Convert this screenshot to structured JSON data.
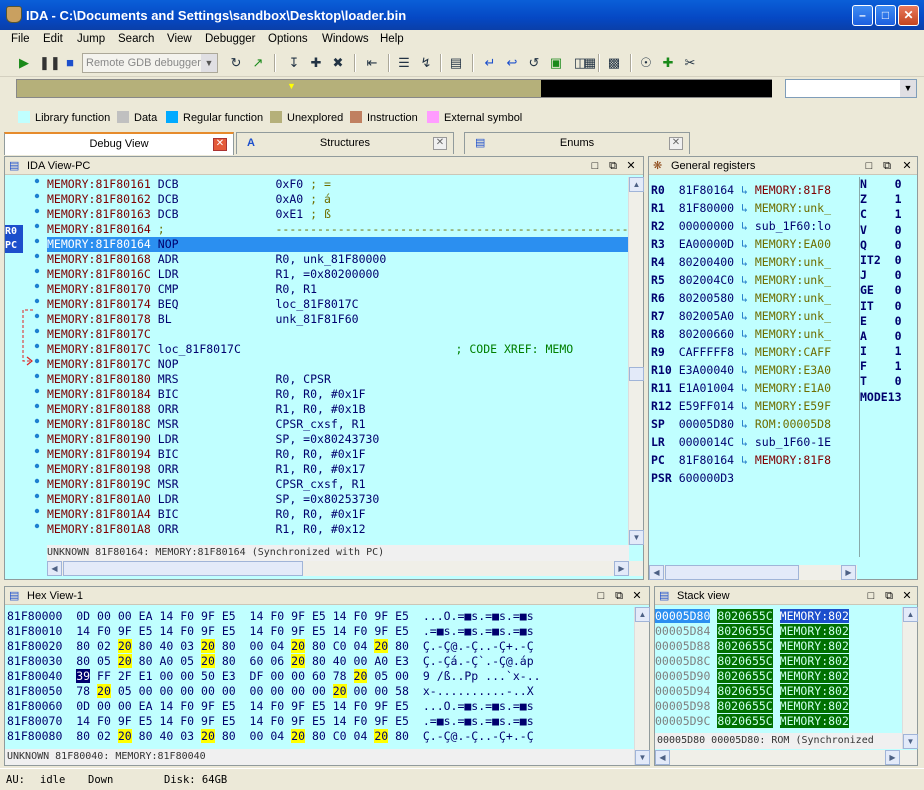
{
  "window": {
    "title": "IDA - C:\\Documents and Settings\\sandbox\\Desktop\\loader.bin"
  },
  "menu": [
    "File",
    "Edit",
    "Jump",
    "Search",
    "View",
    "Debugger",
    "Options",
    "Windows",
    "Help"
  ],
  "toolbar": {
    "debugger_select": "Remote GDB debugger"
  },
  "legend": [
    {
      "label": "Library function",
      "color": "#c0ffff"
    },
    {
      "label": "Data",
      "color": "#c0c0c0"
    },
    {
      "label": "Regular function",
      "color": "#00aaff"
    },
    {
      "label": "Unexplored",
      "color": "#b5b07a"
    },
    {
      "label": "Instruction",
      "color": "#c08060"
    },
    {
      "label": "External symbol",
      "color": "#ff9cff"
    }
  ],
  "tabs": [
    {
      "label": "Debug View",
      "active": true
    },
    {
      "label": "Structures",
      "active": false
    },
    {
      "label": "Enums",
      "active": false
    }
  ],
  "ida_view": {
    "title": "IDA View-PC",
    "markers": [
      "R0",
      "PC"
    ],
    "lines": [
      {
        "a": "MEMORY:81F80161",
        "m": "DCB",
        "o": "0xF0",
        "c": "; ="
      },
      {
        "a": "MEMORY:81F80162",
        "m": "DCB",
        "o": "0xA0",
        "c": "; á"
      },
      {
        "a": "MEMORY:81F80163",
        "m": "DCB",
        "o": "0xE1",
        "c": "; ß"
      },
      {
        "a": "MEMORY:81F80164",
        "m": ";",
        "o": "---------------------------------------------------------------",
        "c": ""
      },
      {
        "a": "MEMORY:81F80164",
        "m": "NOP",
        "o": "",
        "c": "",
        "sel": true
      },
      {
        "a": "MEMORY:81F80168",
        "m": "ADR",
        "o": "R0, unk_81F80000",
        "c": ""
      },
      {
        "a": "MEMORY:81F8016C",
        "m": "LDR",
        "o": "R1, =0x80200000",
        "c": ""
      },
      {
        "a": "MEMORY:81F80170",
        "m": "CMP",
        "o": "R0, R1",
        "c": ""
      },
      {
        "a": "MEMORY:81F80174",
        "m": "BEQ",
        "o": "loc_81F8017C",
        "c": ""
      },
      {
        "a": "MEMORY:81F80178",
        "m": "BL",
        "o": "unk_81F81F60",
        "c": ""
      },
      {
        "a": "MEMORY:81F8017C",
        "m": "",
        "o": "",
        "c": ""
      },
      {
        "a": "MEMORY:81F8017C",
        "m": "loc_81F8017C",
        "o": "",
        "c": "; CODE XREF: MEMO"
      },
      {
        "a": "MEMORY:81F8017C",
        "m": "NOP",
        "o": "",
        "c": ""
      },
      {
        "a": "MEMORY:81F80180",
        "m": "MRS",
        "o": "R0, CPSR",
        "c": ""
      },
      {
        "a": "MEMORY:81F80184",
        "m": "BIC",
        "o": "R0, R0, #0x1F",
        "c": ""
      },
      {
        "a": "MEMORY:81F80188",
        "m": "ORR",
        "o": "R1, R0, #0x1B",
        "c": ""
      },
      {
        "a": "MEMORY:81F8018C",
        "m": "MSR",
        "o": "CPSR_cxsf, R1",
        "c": ""
      },
      {
        "a": "MEMORY:81F80190",
        "m": "LDR",
        "o": "SP, =0x80243730",
        "c": ""
      },
      {
        "a": "MEMORY:81F80194",
        "m": "BIC",
        "o": "R0, R0, #0x1F",
        "c": ""
      },
      {
        "a": "MEMORY:81F80198",
        "m": "ORR",
        "o": "R1, R0, #0x17",
        "c": ""
      },
      {
        "a": "MEMORY:81F8019C",
        "m": "MSR",
        "o": "CPSR_cxsf, R1",
        "c": ""
      },
      {
        "a": "MEMORY:81F801A0",
        "m": "LDR",
        "o": "SP, =0x80253730",
        "c": ""
      },
      {
        "a": "MEMORY:81F801A4",
        "m": "BIC",
        "o": "R0, R0, #0x1F",
        "c": ""
      },
      {
        "a": "MEMORY:81F801A8",
        "m": "ORR",
        "o": "R1, R0, #0x12",
        "c": ""
      }
    ],
    "status": "UNKNOWN 81F80164: MEMORY:81F80164 (Synchronized with PC)"
  },
  "registers": {
    "title": "General registers",
    "rows": [
      {
        "n": "R0",
        "v": "81F80164",
        "s": "MEMORY:81F8",
        "k": "red"
      },
      {
        "n": "R1",
        "v": "81F80000",
        "s": "MEMORY:unk_",
        "k": ""
      },
      {
        "n": "R2",
        "v": "00000000",
        "s": "sub_1F60:lo",
        "k": "blue"
      },
      {
        "n": "R3",
        "v": "EA00000D",
        "s": "MEMORY:EA00",
        "k": ""
      },
      {
        "n": "R4",
        "v": "80200400",
        "s": "MEMORY:unk_",
        "k": ""
      },
      {
        "n": "R5",
        "v": "802004C0",
        "s": "MEMORY:unk_",
        "k": ""
      },
      {
        "n": "R6",
        "v": "80200580",
        "s": "MEMORY:unk_",
        "k": ""
      },
      {
        "n": "R7",
        "v": "802005A0",
        "s": "MEMORY:unk_",
        "k": ""
      },
      {
        "n": "R8",
        "v": "80200660",
        "s": "MEMORY:unk_",
        "k": ""
      },
      {
        "n": "R9",
        "v": "CAFFFFF8",
        "s": "MEMORY:CAFF",
        "k": ""
      },
      {
        "n": "R10",
        "v": "E3A00040",
        "s": "MEMORY:E3A0",
        "k": ""
      },
      {
        "n": "R11",
        "v": "E1A01004",
        "s": "MEMORY:E1A0",
        "k": ""
      },
      {
        "n": "R12",
        "v": "E59FF014",
        "s": "MEMORY:E59F",
        "k": ""
      },
      {
        "n": "SP",
        "v": "00005D80",
        "s": "ROM:00005D8",
        "k": ""
      },
      {
        "n": "LR",
        "v": "0000014C",
        "s": "sub_1F60-1E",
        "k": "blue"
      },
      {
        "n": "PC",
        "v": "81F80164",
        "s": "MEMORY:81F8",
        "k": "red"
      },
      {
        "n": "PSR",
        "v": "600000D3",
        "s": "",
        "k": ""
      }
    ],
    "flags": [
      {
        "n": "N",
        "v": "0"
      },
      {
        "n": "Z",
        "v": "1"
      },
      {
        "n": "C",
        "v": "1"
      },
      {
        "n": "V",
        "v": "0"
      },
      {
        "n": "Q",
        "v": "0"
      },
      {
        "n": "IT2",
        "v": "0"
      },
      {
        "n": "J",
        "v": "0"
      },
      {
        "n": "GE",
        "v": "0"
      },
      {
        "n": "IT",
        "v": "0"
      },
      {
        "n": "E",
        "v": "0"
      },
      {
        "n": "A",
        "v": "0"
      },
      {
        "n": "I",
        "v": "1"
      },
      {
        "n": "F",
        "v": "1"
      },
      {
        "n": "T",
        "v": "0"
      },
      {
        "n": "MODE",
        "v": "13"
      }
    ]
  },
  "hex_view": {
    "title": "Hex View-1",
    "rows": [
      {
        "a": "81F80000",
        "b": [
          "0D",
          "00",
          "00",
          "EA",
          "14",
          "F0",
          "9F",
          "E5",
          "14",
          "F0",
          "9F",
          "E5",
          "14",
          "F0",
          "9F",
          "E5"
        ],
        "t": "...O.=■s.=■s.=■s"
      },
      {
        "a": "81F80010",
        "b": [
          "14",
          "F0",
          "9F",
          "E5",
          "14",
          "F0",
          "9F",
          "E5",
          "14",
          "F0",
          "9F",
          "E5",
          "14",
          "F0",
          "9F",
          "E5"
        ],
        "t": ".=■s.=■s.=■s.=■s"
      },
      {
        "a": "81F80020",
        "b": [
          "80",
          "02",
          "20",
          "80",
          "40",
          "03",
          "20",
          "80",
          "00",
          "04",
          "20",
          "80",
          "C0",
          "04",
          "20",
          "80"
        ],
        "t": "Ç.-Ç@.-Ç..-Ç+.-Ç"
      },
      {
        "a": "81F80030",
        "b": [
          "80",
          "05",
          "20",
          "80",
          "A0",
          "05",
          "20",
          "80",
          "60",
          "06",
          "20",
          "80",
          "40",
          "00",
          "A0",
          "E3"
        ],
        "t": "Ç.-Çá.-Ç`.-Ç@.áp"
      },
      {
        "a": "81F80040",
        "b": [
          "39",
          "FF",
          "2F",
          "E1",
          "00",
          "00",
          "50",
          "E3",
          "DF",
          "00",
          "00",
          "60",
          "78",
          "20",
          "05",
          "00"
        ],
        "t": "9 /ß..Pp ...`x-.."
      },
      {
        "a": "81F80050",
        "b": [
          "78",
          "20",
          "05",
          "00",
          "00",
          "00",
          "00",
          "00",
          "00",
          "00",
          "00",
          "00",
          "20",
          "00",
          "00",
          "58"
        ],
        "t": "x-..........-..X"
      },
      {
        "a": "81F80060",
        "b": [
          "0D",
          "00",
          "00",
          "EA",
          "14",
          "F0",
          "9F",
          "E5",
          "14",
          "F0",
          "9F",
          "E5",
          "14",
          "F0",
          "9F",
          "E5"
        ],
        "t": "...O.=■s.=■s.=■s"
      },
      {
        "a": "81F80070",
        "b": [
          "14",
          "F0",
          "9F",
          "E5",
          "14",
          "F0",
          "9F",
          "E5",
          "14",
          "F0",
          "9F",
          "E5",
          "14",
          "F0",
          "9F",
          "E5"
        ],
        "t": ".=■s.=■s.=■s.=■s"
      },
      {
        "a": "81F80080",
        "b": [
          "80",
          "02",
          "20",
          "80",
          "40",
          "03",
          "20",
          "80",
          "00",
          "04",
          "20",
          "80",
          "C0",
          "04",
          "20",
          "80"
        ],
        "t": "Ç.-Ç@.-Ç..-Ç+.-Ç"
      }
    ],
    "status": "UNKNOWN 81F80040: MEMORY:81F80040"
  },
  "stack_view": {
    "title": "Stack view",
    "rows": [
      {
        "a": "00005D80",
        "v": "8020655C",
        "m": "MEMORY:802"
      },
      {
        "a": "00005D84",
        "v": "8020655C",
        "m": "MEMORY:802"
      },
      {
        "a": "00005D88",
        "v": "8020655C",
        "m": "MEMORY:802"
      },
      {
        "a": "00005D8C",
        "v": "8020655C",
        "m": "MEMORY:802"
      },
      {
        "a": "00005D90",
        "v": "8020655C",
        "m": "MEMORY:802"
      },
      {
        "a": "00005D94",
        "v": "8020655C",
        "m": "MEMORY:802"
      },
      {
        "a": "00005D98",
        "v": "8020655C",
        "m": "MEMORY:802"
      },
      {
        "a": "00005D9C",
        "v": "8020655C",
        "m": "MEMORY:802"
      }
    ],
    "status": "00005D80 00005D80: ROM (Synchronized"
  },
  "statusbar": {
    "au_label": "AU:",
    "au_value": "idle",
    "direction": "Down",
    "disk": "Disk: 64GB"
  }
}
